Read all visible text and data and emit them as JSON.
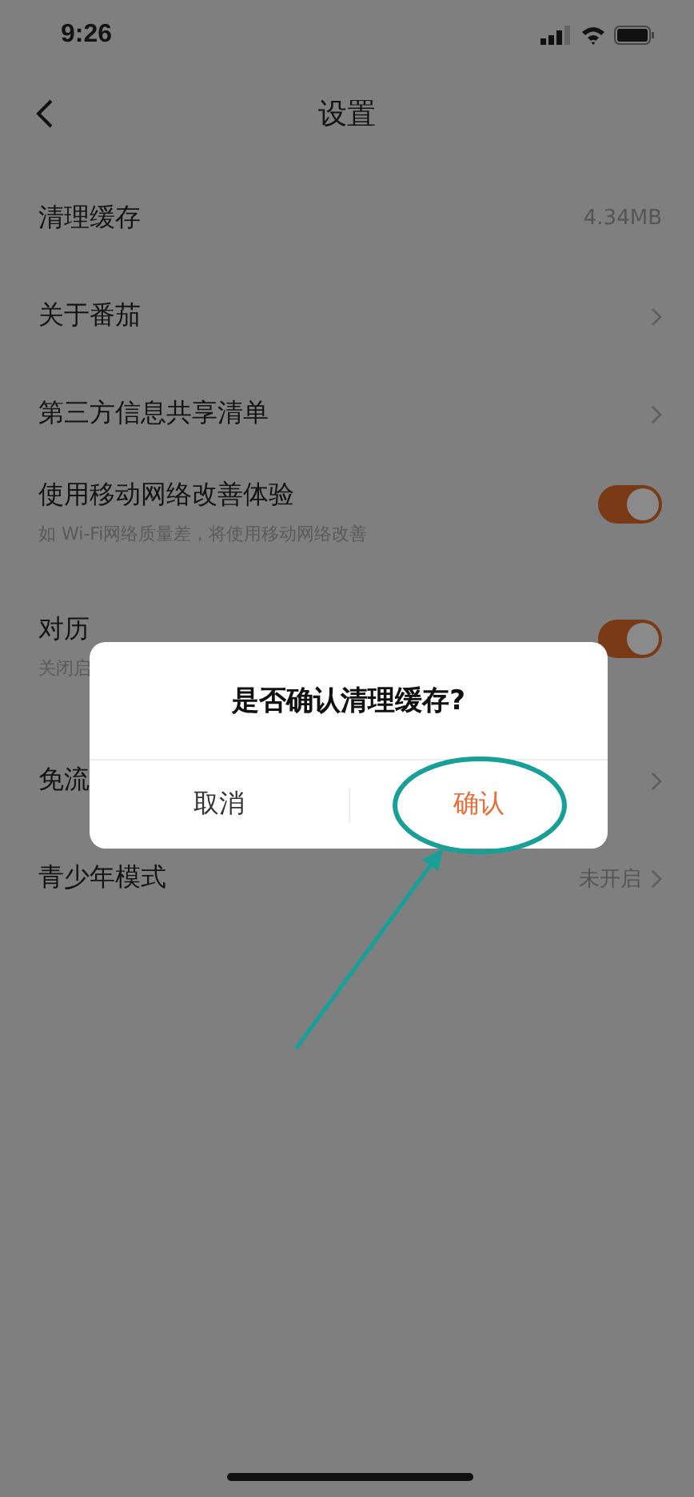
{
  "status_bar": {
    "time": "9:26"
  },
  "header": {
    "title": "设置"
  },
  "settings": [
    {
      "kind": "value",
      "label": "清理缓存",
      "value": "4.34MB"
    },
    {
      "kind": "link",
      "label": "关于番茄"
    },
    {
      "kind": "link",
      "label": "第三方信息共享清单"
    },
    {
      "kind": "toggle",
      "label": "使用移动网络改善体验",
      "sublabel": "如 Wi-Fi网络质量差，将使用移动网络改善",
      "on": true
    },
    {
      "kind": "toggle",
      "label": "对历",
      "sublabel": "关闭启",
      "on": true
    },
    {
      "kind": "link",
      "label": "免流"
    },
    {
      "kind": "link",
      "label": "青少年模式",
      "value": "未开启"
    }
  ],
  "dialog": {
    "title": "是否确认清理缓存?",
    "buttons": [
      {
        "label": "取消",
        "kind": "cancel"
      },
      {
        "label": "确认",
        "kind": "confirm"
      }
    ]
  }
}
